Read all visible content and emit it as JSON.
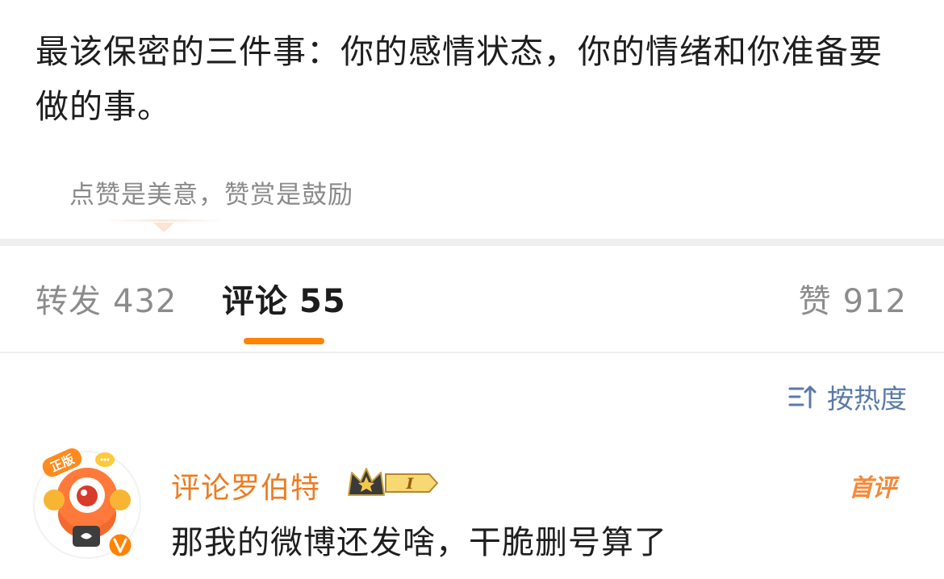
{
  "post": {
    "text": "最该保密的三件事：你的感情状态，你的情绪和你准备要做的事。",
    "reward_text": "点赞是美意，赞赏是鼓励"
  },
  "tabs": [
    {
      "label": "转发",
      "count": "432"
    },
    {
      "label": "评论",
      "count": "55"
    },
    {
      "label": "赞",
      "count": "912"
    }
  ],
  "sort": {
    "label": "按热度",
    "icon": "sort-icon"
  },
  "comments": [
    {
      "author": "评论罗伯特",
      "avatar_badge_text": "正版",
      "level_badge_text": "I",
      "verified_icon": "v-badge-icon",
      "tag": "首评",
      "text": "那我的微博还发啥，干脆删号算了"
    }
  ],
  "colors": {
    "accent": "#ff8200",
    "nickname": "#ee7b20",
    "link_blue": "#5b7aa6"
  }
}
